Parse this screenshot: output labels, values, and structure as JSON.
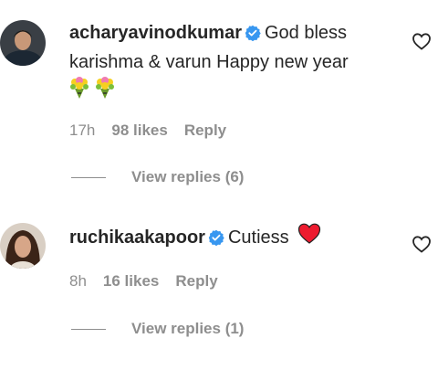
{
  "comments": [
    {
      "username": "acharyavinodkumar",
      "text_line1": "God bless",
      "text_line2": "karishma & varun Happy new year",
      "emoji": [
        "bouquet",
        "bouquet"
      ],
      "time": "17h",
      "likes": "98 likes",
      "reply": "Reply",
      "view_replies": "View replies (6)",
      "verified": true
    },
    {
      "username": "ruchikaakapoor",
      "text": "Cutiess",
      "emoji": [
        "red-heart"
      ],
      "time": "8h",
      "likes": "16 likes",
      "reply": "Reply",
      "view_replies": "View replies (1)",
      "verified": true
    }
  ],
  "colors": {
    "verified": "#3897f0",
    "muted": "#8e8e8e",
    "text": "#262626",
    "heart": "#ed1b2f"
  }
}
